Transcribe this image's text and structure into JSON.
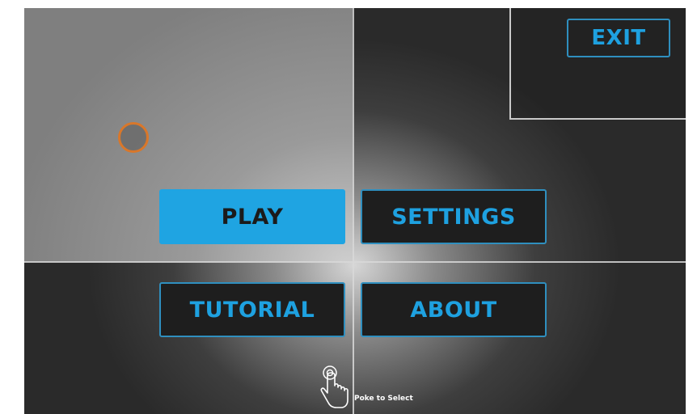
{
  "menu": {
    "exit_label": "EXIT",
    "play_label": "PLAY",
    "settings_label": "SETTINGS",
    "tutorial_label": "TUTORIAL",
    "about_label": "ABOUT"
  },
  "hint": {
    "text": "Poke to Select",
    "icon": "hand-pointer-icon"
  },
  "cursor": {
    "icon": "ring-cursor-icon"
  },
  "colors": {
    "accent": "#1fa4e2",
    "button_bg": "#1e1e1e",
    "cursor_ring": "#d9772a"
  }
}
